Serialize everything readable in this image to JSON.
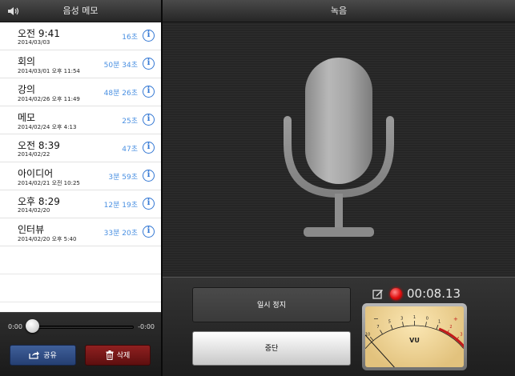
{
  "left_header": {
    "title": "음성 메모"
  },
  "memos": [
    {
      "title": "오전 9:41",
      "date": "2014/03/03",
      "duration": "16초"
    },
    {
      "title": "회의",
      "date": "2014/03/01 오후 11:54",
      "duration": "50분 34초"
    },
    {
      "title": "강의",
      "date": "2014/02/26 오후 11:49",
      "duration": "48분 26초"
    },
    {
      "title": "메모",
      "date": "2014/02/24 오후 4:13",
      "duration": "25초"
    },
    {
      "title": "오전 8:39",
      "date": "2014/02/22",
      "duration": "47초"
    },
    {
      "title": "아이디어",
      "date": "2014/02/21 오전 10:25",
      "duration": "3분 59초"
    },
    {
      "title": "오후 8:29",
      "date": "2014/02/20",
      "duration": "12분 19초"
    },
    {
      "title": "인터뷰",
      "date": "2014/02/20 오후 5:40",
      "duration": "33분 20초"
    }
  ],
  "player": {
    "elapsed": "0:00",
    "remaining": "-0:00",
    "share_label": "공유",
    "delete_label": "삭제"
  },
  "right_header": {
    "title": "녹음"
  },
  "recorder": {
    "pause_label": "일시 정지",
    "stop_label": "중단",
    "elapsed": "00:08.13"
  },
  "vu_meter": {
    "label": "VU",
    "scale": [
      "20",
      "10",
      "7",
      "5",
      "3",
      "1",
      "0",
      "1",
      "2",
      "3",
      "+"
    ],
    "minus_sign": "−",
    "plus_sign": "+",
    "needle_level": 0.08
  },
  "colors": {
    "duration_text": "#4a90e2",
    "share_button": "#2f4f8a",
    "delete_button": "#7a1515",
    "record_dot": "#e01010"
  }
}
